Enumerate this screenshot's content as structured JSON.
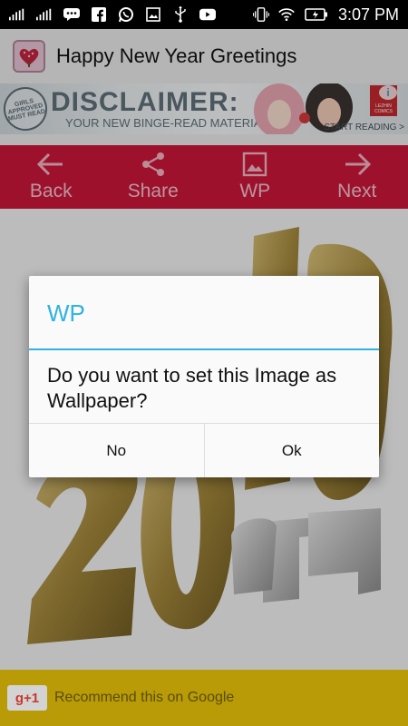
{
  "status_bar": {
    "time": "3:07 PM",
    "icons": [
      "signal-icon",
      "signal-icon",
      "message-icon",
      "facebook-icon",
      "whatsapp-icon",
      "image-icon",
      "usb-icon",
      "youtube-icon",
      "vibrate-icon",
      "wifi-icon",
      "battery-icon"
    ]
  },
  "app_bar": {
    "title": "Happy New Year Greetings",
    "logo_icon": "heart-tree-icon"
  },
  "ad": {
    "seal_text": "GIRLS APPROVED MUST READ",
    "headline": "DISCLAIMER:",
    "subtext": "YOUR NEW BINGE-READ MATERIAL!",
    "cta": "START READING >",
    "badge_text": "LEZHIN COMICS",
    "info_label": "i"
  },
  "toolbar": {
    "back_label": "Back",
    "share_label": "Share",
    "wp_label": "WP",
    "next_label": "Next"
  },
  "wallpaper": {
    "subject": "2019 gold and silver 3D numerals",
    "colors": {
      "gold": "#b89846",
      "silver": "#b9b9b9"
    }
  },
  "dialog": {
    "title": "WP",
    "message": "Do you want to set this Image as Wallpaper?",
    "no_label": "No",
    "ok_label": "Ok",
    "accent_color": "#2fb3df"
  },
  "bottom_bar": {
    "gplus_label": "g+1",
    "text": "Recommend this on Google"
  },
  "colors": {
    "toolbar_bg": "#c9163a",
    "bottom_bar_bg": "#b89b07"
  }
}
